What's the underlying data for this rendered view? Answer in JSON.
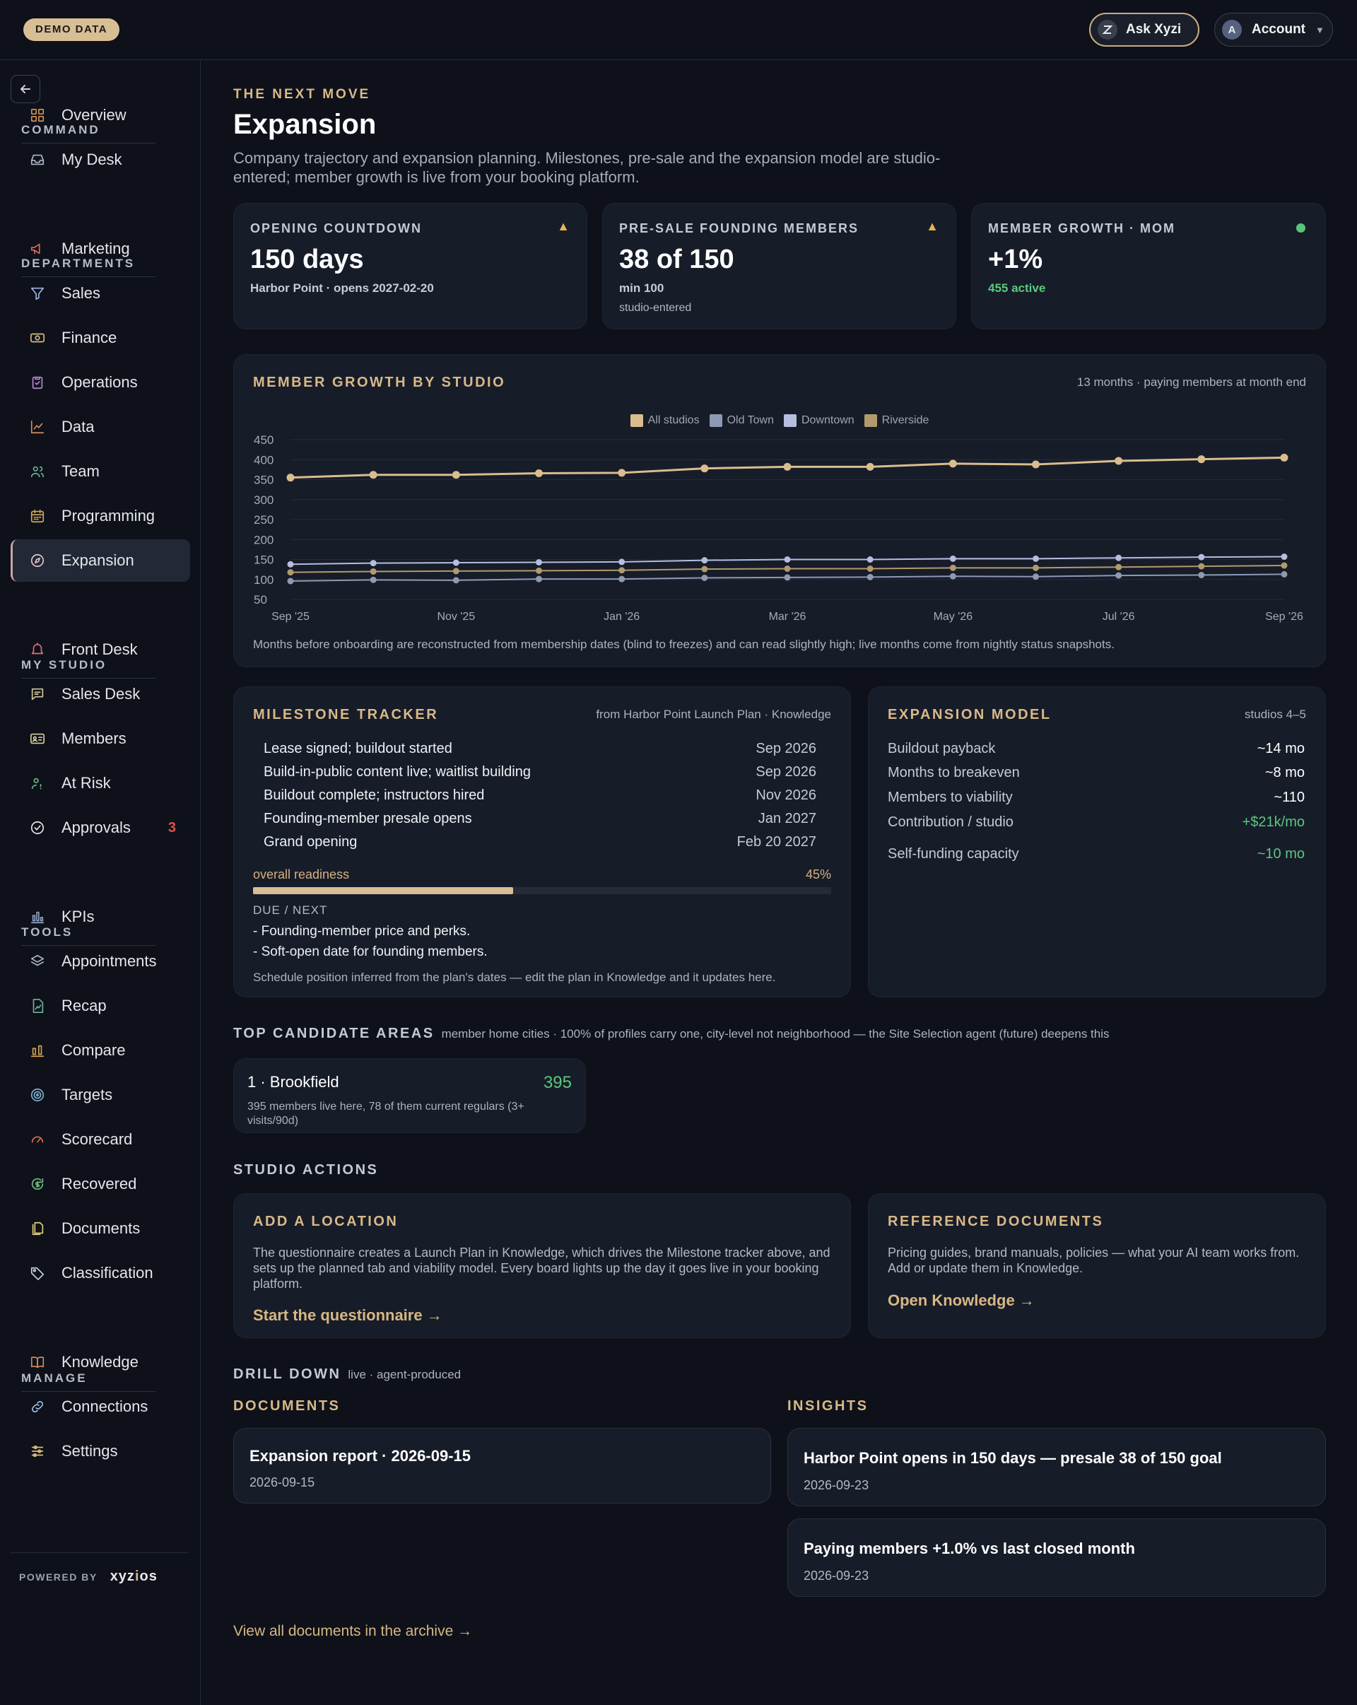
{
  "topbar": {
    "demo_badge": "DEMO DATA",
    "ask_label": "Ask Xyzi",
    "account_label": "Account",
    "account_initial": "A"
  },
  "sidebar": {
    "sections": {
      "command": "COMMAND",
      "departments": "DEPARTMENTS",
      "my_studio": "MY STUDIO",
      "tools": "TOOLS",
      "manage": "MANAGE"
    },
    "items": [
      {
        "label": "Overview",
        "icon": "grid-icon"
      },
      {
        "label": "My Desk",
        "icon": "inbox-icon"
      },
      {
        "label": "Marketing",
        "icon": "megaphone-icon"
      },
      {
        "label": "Sales",
        "icon": "funnel-icon"
      },
      {
        "label": "Finance",
        "icon": "banknote-icon"
      },
      {
        "label": "Operations",
        "icon": "clipboard-icon"
      },
      {
        "label": "Data",
        "icon": "line-chart-icon"
      },
      {
        "label": "Team",
        "icon": "users-icon"
      },
      {
        "label": "Programming",
        "icon": "calendar-icon"
      },
      {
        "label": "Expansion",
        "icon": "compass-icon"
      },
      {
        "label": "Front Desk",
        "icon": "bell-icon"
      },
      {
        "label": "Sales Desk",
        "icon": "message-icon"
      },
      {
        "label": "Members",
        "icon": "id-card-icon"
      },
      {
        "label": "At Risk",
        "icon": "user-alert-icon"
      },
      {
        "label": "Approvals",
        "icon": "check-circle-icon",
        "badge": "3"
      },
      {
        "label": "KPIs",
        "icon": "bar-chart-icon"
      },
      {
        "label": "Appointments",
        "icon": "layers-icon"
      },
      {
        "label": "Recap",
        "icon": "file-chart-icon"
      },
      {
        "label": "Compare",
        "icon": "compare-bars-icon"
      },
      {
        "label": "Targets",
        "icon": "target-icon"
      },
      {
        "label": "Scorecard",
        "icon": "gauge-icon"
      },
      {
        "label": "Recovered",
        "icon": "refresh-dollar-icon"
      },
      {
        "label": "Documents",
        "icon": "documents-icon"
      },
      {
        "label": "Classification",
        "icon": "tag-icon"
      },
      {
        "label": "Knowledge",
        "icon": "book-icon"
      },
      {
        "label": "Connections",
        "icon": "link-icon"
      },
      {
        "label": "Settings",
        "icon": "sliders-icon"
      }
    ],
    "powered_by": "POWERED BY",
    "brand_a": "xyz",
    "brand_b": "i",
    "brand_c": "os"
  },
  "header": {
    "eyebrow": "THE NEXT MOVE",
    "title": "Expansion",
    "description": "Company trajectory and expansion planning. Milestones, pre-sale and the expansion model are studio-entered; member growth is live from your booking platform."
  },
  "kpis": [
    {
      "label": "OPENING COUNTDOWN",
      "value": "150 days",
      "sub": "Harbor Point · opens 2027-02-20",
      "sub2": "",
      "status": "warning"
    },
    {
      "label": "PRE-SALE FOUNDING MEMBERS",
      "value": "38 of 150",
      "sub": "min 100",
      "sub2": "studio-entered",
      "status": "warning"
    },
    {
      "label": "MEMBER GROWTH · MOM",
      "value": "+1%",
      "sub": "455 active",
      "sub2": "",
      "status": "ok"
    }
  ],
  "colors": {
    "accent": "#d8b988",
    "positive": "#5bc97d",
    "warning": "#e3b555",
    "danger": "#e0524a"
  },
  "growth_chart": {
    "title": "MEMBER GROWTH BY STUDIO",
    "meta": "13 months · paying members at month end",
    "note": "Months before onboarding are reconstructed from membership dates (blind to freezes) and can read slightly high; live months come from nightly status snapshots."
  },
  "chart_data": {
    "type": "line",
    "x": [
      "Sep '25",
      "Oct '25",
      "Nov '25",
      "Dec '25",
      "Jan '26",
      "Feb '26",
      "Mar '26",
      "Apr '26",
      "May '26",
      "Jun '26",
      "Jul '26",
      "Aug '26",
      "Sep '26"
    ],
    "x_tick_labels": [
      "Sep '25",
      "Nov '25",
      "Jan '26",
      "Mar '26",
      "May '26",
      "Jul '26",
      "Sep '26"
    ],
    "yticks": [
      50,
      100,
      150,
      200,
      250,
      300,
      350,
      400,
      450
    ],
    "ylim": [
      50,
      450
    ],
    "grid": true,
    "legend": "top-center",
    "series": [
      {
        "name": "All studios",
        "color": "#d9bd8c",
        "values": [
          355,
          362,
          362,
          366,
          367,
          378,
          382,
          382,
          390,
          388,
          397,
          401,
          405
        ]
      },
      {
        "name": "Old Town",
        "color": "#8e9ab2",
        "values": [
          96,
          99,
          98,
          101,
          101,
          104,
          105,
          106,
          108,
          107,
          110,
          111,
          113
        ]
      },
      {
        "name": "Downtown",
        "color": "#b5bde0",
        "values": [
          138,
          141,
          142,
          143,
          144,
          148,
          150,
          150,
          152,
          152,
          154,
          156,
          157
        ]
      },
      {
        "name": "Riverside",
        "color": "#b29a6c",
        "values": [
          118,
          120,
          121,
          122,
          123,
          126,
          127,
          127,
          129,
          129,
          131,
          133,
          135
        ]
      }
    ]
  },
  "milestones": {
    "title": "MILESTONE TRACKER",
    "meta": "from Harbor Point Launch Plan · Knowledge",
    "items": [
      {
        "label": "Lease signed; buildout started",
        "date": "Sep 2026"
      },
      {
        "label": "Build-in-public content live; waitlist building",
        "date": "Sep 2026"
      },
      {
        "label": "Buildout complete; instructors hired",
        "date": "Nov 2026"
      },
      {
        "label": "Founding-member presale opens",
        "date": "Jan 2027"
      },
      {
        "label": "Grand opening",
        "date": "Feb 20 2027"
      }
    ],
    "readiness_label": "overall readiness",
    "readiness_value": "45%",
    "readiness_fraction": 0.45,
    "due_label": "DUE / NEXT",
    "due_items": [
      "- Founding-member price and perks.",
      "- Soft-open date for founding members."
    ],
    "footnote": "Schedule position inferred from the plan's dates — edit the plan in Knowledge and it updates here."
  },
  "expansion_model": {
    "title": "EXPANSION MODEL",
    "meta": "studios 4–5",
    "rows": [
      {
        "label": "Buildout payback",
        "value": "~14 mo",
        "positive": false
      },
      {
        "label": "Months to breakeven",
        "value": "~8 mo",
        "positive": false
      },
      {
        "label": "Members to viability",
        "value": "~110",
        "positive": false
      },
      {
        "label": "Contribution / studio",
        "value": "+$21k/mo",
        "positive": true
      },
      {
        "label": "Self-funding capacity",
        "value": "~10 mo",
        "positive": true
      }
    ]
  },
  "candidates": {
    "title": "TOP CANDIDATE AREAS",
    "meta": "member home cities · 100% of profiles carry one, city-level not neighborhood — the Site Selection agent (future) deepens this",
    "items": [
      {
        "name": "1 · Brookfield",
        "value": "395",
        "desc": "395 members live here, 78 of them current regulars (3+ visits/90d)"
      }
    ]
  },
  "studio_actions": {
    "title": "STUDIO ACTIONS",
    "cards": [
      {
        "title": "ADD A LOCATION",
        "body": "The questionnaire creates a Launch Plan in Knowledge, which drives the Milestone tracker above, and sets up the planned tab and viability model. Every board lights up the day it goes live in your booking platform.",
        "link": "Start the questionnaire →"
      },
      {
        "title": "REFERENCE DOCUMENTS",
        "body": "Pricing guides, brand manuals, policies — what your AI team works from. Add or update them in Knowledge.",
        "link": "Open Knowledge →"
      }
    ]
  },
  "drilldown": {
    "title": "DRILL DOWN",
    "meta": "live · agent-produced",
    "documents_title": "DOCUMENTS",
    "insights_title": "INSIGHTS",
    "documents": [
      {
        "title": "Expansion report · 2026-09-15",
        "date": "2026-09-15"
      }
    ],
    "insights": [
      {
        "title": "Harbor Point opens in 150 days — presale 38 of 150 goal",
        "date": "2026-09-23"
      },
      {
        "title": "Paying members +1.0% vs last closed month",
        "date": "2026-09-23"
      }
    ],
    "archive_link": "View all documents in the archive →"
  }
}
